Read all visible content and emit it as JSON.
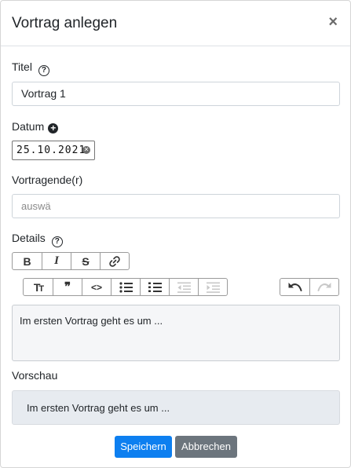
{
  "modal": {
    "title": "Vortrag anlegen",
    "close_symbol": "×"
  },
  "fields": {
    "title_label": "Titel",
    "title_value": "Vortrag 1",
    "date_label": "Datum",
    "date_value": "25.10.2021",
    "speaker_label": "Vortragende(r)",
    "speaker_placeholder": "auswä",
    "details_label": "Details"
  },
  "icons": {
    "help": "help-circle-icon",
    "plus": "plus-circle-icon",
    "clear": "clear-icon"
  },
  "toolbar": {
    "bold": "B",
    "italic": "I",
    "strike": "S",
    "heading": "TT",
    "quote": "❞",
    "code": "<>"
  },
  "editor": {
    "content": "Im ersten Vortrag geht es um ..."
  },
  "preview": {
    "label": "Vorschau",
    "content": "Im ersten Vortrag geht es um ..."
  },
  "buttons": {
    "save": "Speichern",
    "cancel": "Abbrechen"
  },
  "colors": {
    "primary": "#0d7ff0",
    "secondary": "#6c757d",
    "editor_bg": "#f5f6f8",
    "preview_bg": "#e7ebf0"
  }
}
